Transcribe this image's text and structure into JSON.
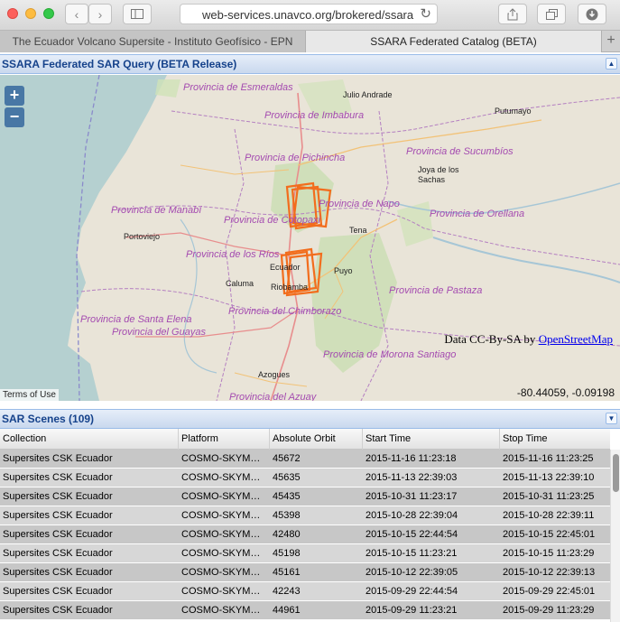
{
  "browser": {
    "url": "web-services.unavco.org/brokered/ssara",
    "tabs": [
      {
        "label": "The Ecuador Volcano Supersite - Instituto Geofísico - EPN"
      },
      {
        "label": "SSARA Federated Catalog (BETA)"
      }
    ]
  },
  "map_panel": {
    "title": "SSARA Federated SAR Query (BETA Release)",
    "zoom_in": "+",
    "zoom_out": "−",
    "attribution_prefix": "Data CC-By-SA by ",
    "attribution_link": "OpenStreetMap",
    "terms": "Terms of Use",
    "coordinates": "-80.44059, -0.09198",
    "provinces": [
      "Provincia de Esmeraldas",
      "Provincia de Imbabura",
      "Provincia de Sucumbíos",
      "Provincia de Pichincha",
      "Provincia de Manabí",
      "Provincia de Napo",
      "Provincia de Orellana",
      "Provincia de Cotopaxi",
      "Provincia de los Ríos",
      "Provincia de Pastaza",
      "Provincia del Chimborazo",
      "Provincia de Santa Elena",
      "Provincia del Guayas",
      "Provincia de Morona Santiago",
      "Provincia del Azuay"
    ],
    "cities": [
      "Julio Andrade",
      "Putumayo",
      "Joya de los Sachas",
      "Portoviejo",
      "Tena",
      "Ecuador",
      "Puyo",
      "Caluma",
      "Riobamba",
      "Azogues"
    ]
  },
  "scenes_panel": {
    "title": "SAR Scenes (109)",
    "columns": [
      "Collection",
      "Platform",
      "Absolute Orbit",
      "Start Time",
      "Stop Time"
    ],
    "rows": [
      [
        "Supersites CSK Ecuador",
        "COSMO-SKYM…",
        "45672",
        "2015-11-16 11:23:18",
        "2015-11-16 11:23:25"
      ],
      [
        "Supersites CSK Ecuador",
        "COSMO-SKYM…",
        "45635",
        "2015-11-13 22:39:03",
        "2015-11-13 22:39:10"
      ],
      [
        "Supersites CSK Ecuador",
        "COSMO-SKYM…",
        "45435",
        "2015-10-31 11:23:17",
        "2015-10-31 11:23:25"
      ],
      [
        "Supersites CSK Ecuador",
        "COSMO-SKYM…",
        "45398",
        "2015-10-28 22:39:04",
        "2015-10-28 22:39:11"
      ],
      [
        "Supersites CSK Ecuador",
        "COSMO-SKYM…",
        "42480",
        "2015-10-15 22:44:54",
        "2015-10-15 22:45:01"
      ],
      [
        "Supersites CSK Ecuador",
        "COSMO-SKYM…",
        "45198",
        "2015-10-15 11:23:21",
        "2015-10-15 11:23:29"
      ],
      [
        "Supersites CSK Ecuador",
        "COSMO-SKYM…",
        "45161",
        "2015-10-12 22:39:05",
        "2015-10-12 22:39:13"
      ],
      [
        "Supersites CSK Ecuador",
        "COSMO-SKYM…",
        "42243",
        "2015-09-29 22:44:54",
        "2015-09-29 22:45:01"
      ],
      [
        "Supersites CSK Ecuador",
        "COSMO-SKYM…",
        "44961",
        "2015-09-29 11:23:21",
        "2015-09-29 11:23:29"
      ]
    ]
  }
}
